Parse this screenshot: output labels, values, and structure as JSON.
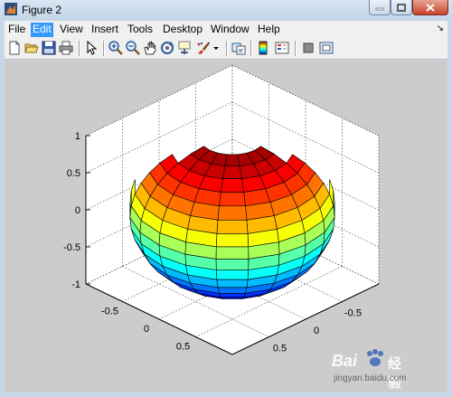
{
  "window": {
    "title": "Figure 2"
  },
  "menu": [
    {
      "label": "File",
      "active": false
    },
    {
      "label": "Edit",
      "active": true
    },
    {
      "label": "View",
      "active": false
    },
    {
      "label": "Insert",
      "active": false
    },
    {
      "label": "Tools",
      "active": false
    },
    {
      "label": "Desktop",
      "active": false
    },
    {
      "label": "Window",
      "active": false
    },
    {
      "label": "Help",
      "active": false
    }
  ],
  "menu_dock_arrow": "↘",
  "toolbar": [
    "new-figure-icon",
    "open-file-icon",
    "save-icon",
    "print-icon",
    "select-arrow-icon",
    "zoom-in-icon",
    "zoom-out-icon",
    "pan-icon",
    "rotate-3d-icon",
    "data-cursor-icon",
    "brush-icon",
    "link-plot-icon",
    "colorbar-icon",
    "legend-icon",
    "hide-plot-tools-icon",
    "show-plot-tools-icon"
  ],
  "axes": {
    "z_ticks": [
      "1",
      "0.5",
      "0",
      "-0.5",
      "-1"
    ],
    "y_ticks": [
      "0.5",
      "0",
      "-0.5"
    ],
    "x_ticks": [
      "0.5",
      "0",
      "-0.5"
    ]
  },
  "plot": {
    "type": "surface",
    "object": "sphere",
    "colormap": "jet"
  },
  "watermark": {
    "brand": "Bai",
    "brand2": "经验",
    "url": "jingyan.baidu.com"
  }
}
